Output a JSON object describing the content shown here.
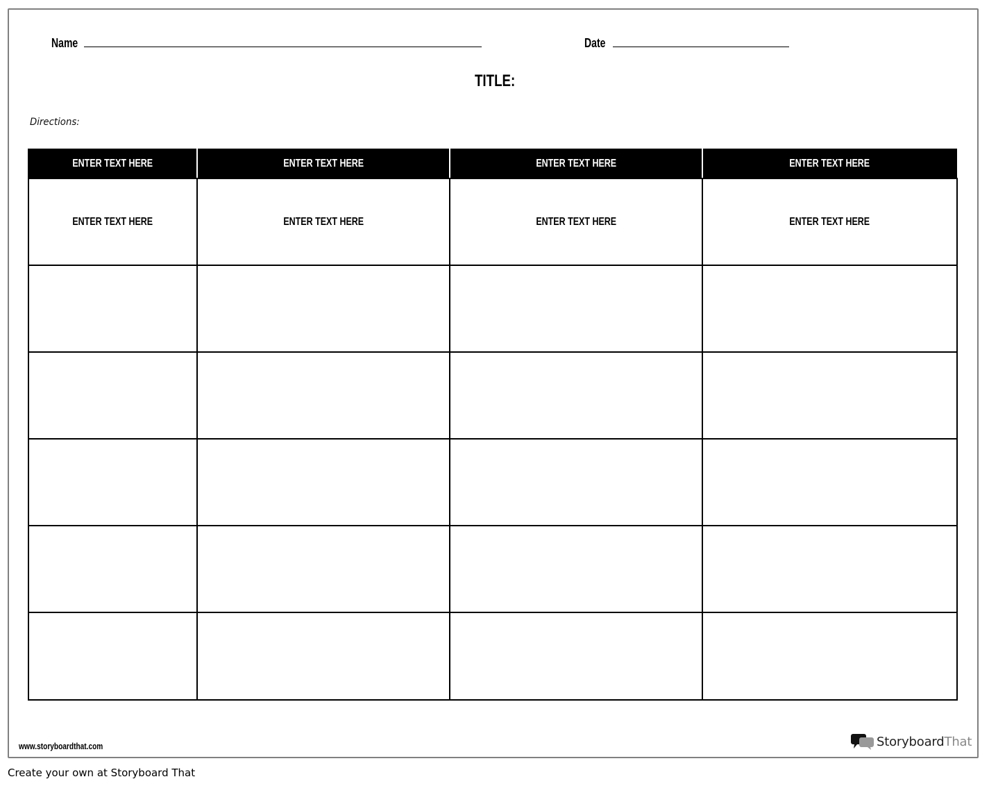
{
  "worksheet": {
    "name_label": "Name",
    "date_label": "Date",
    "title_label": "TITLE:",
    "directions_label": "Directions:",
    "table": {
      "headers": [
        "ENTER TEXT HERE",
        "ENTER TEXT HERE",
        "ENTER TEXT HERE",
        "ENTER TEXT HERE"
      ],
      "rows": [
        [
          "ENTER TEXT HERE",
          "ENTER TEXT HERE",
          "ENTER TEXT HERE",
          "ENTER TEXT HERE"
        ],
        [
          "",
          "",
          "",
          ""
        ],
        [
          "",
          "",
          "",
          ""
        ],
        [
          "",
          "",
          "",
          ""
        ],
        [
          "",
          "",
          "",
          ""
        ],
        [
          "",
          "",
          "",
          ""
        ]
      ]
    },
    "footer_url": "www.storyboardthat.com",
    "logo": {
      "brand_main": "Storyboard",
      "brand_suffix": "That",
      "icon": "speech-bubbles-icon"
    }
  },
  "caption": "Create your own at Storyboard That",
  "colors": {
    "frame_border": "#808080",
    "header_bg": "#000000",
    "header_text": "#ffffff",
    "logo_gray": "#888888"
  }
}
